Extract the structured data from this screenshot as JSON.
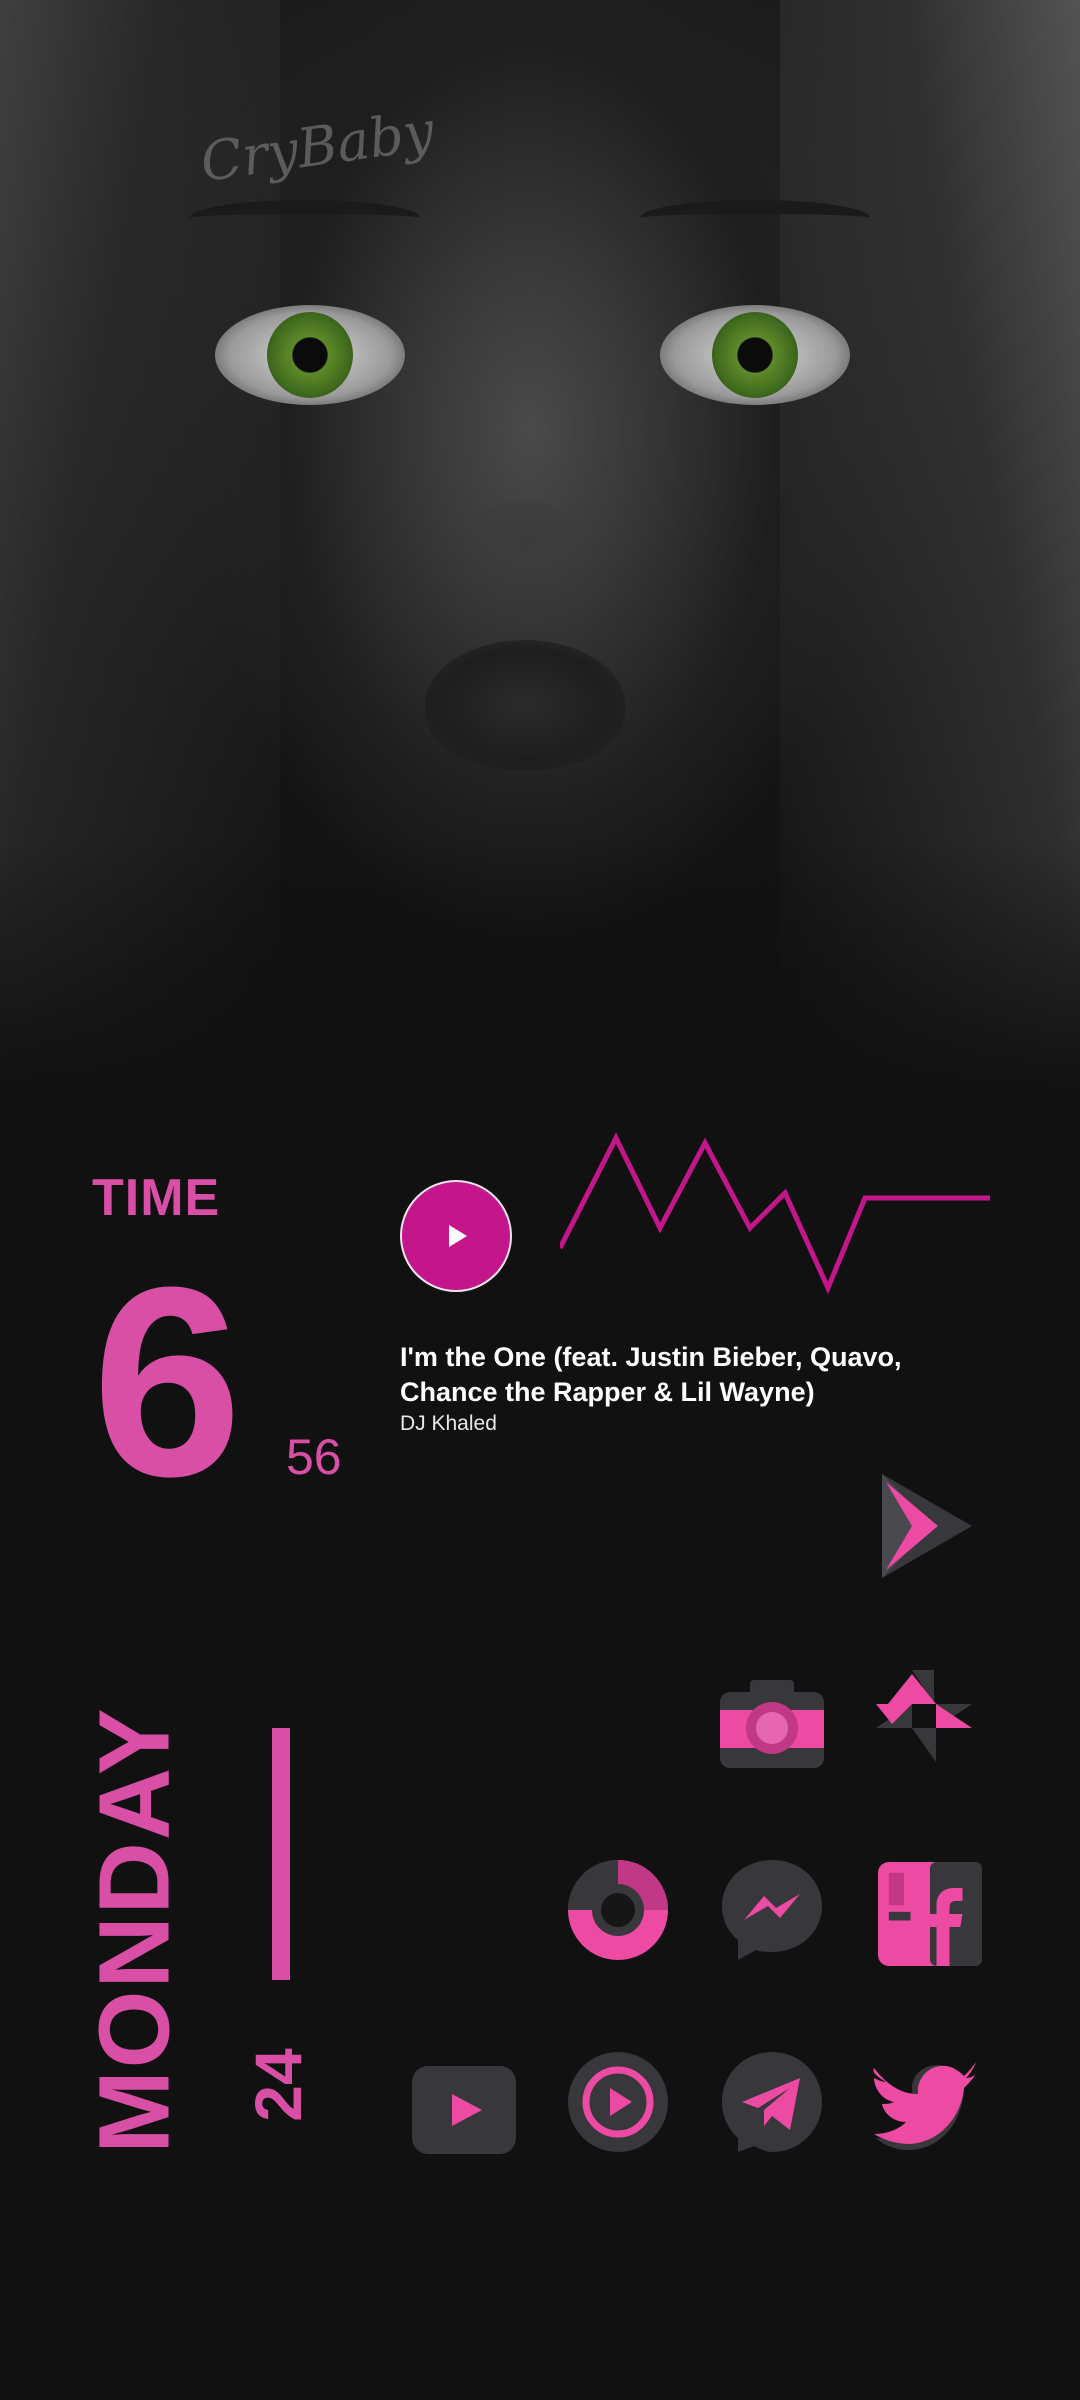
{
  "clock": {
    "label": "TIME",
    "hour": "6",
    "minute": "56"
  },
  "date": {
    "weekday": "MONDAY",
    "day": "24"
  },
  "media": {
    "title": "I'm the One (feat. Justin Bieber, Quavo, Chance the Rapper & Lil Wayne)",
    "artist": "DJ Khaled"
  },
  "wallpaper": {
    "tattoo_text": "CryBaby"
  },
  "colors": {
    "accent": "#d94fa6",
    "accent_dark": "#c4168b",
    "icon_bg": "#38373c",
    "background": "#111112"
  },
  "apps": [
    {
      "name": "play-store-icon"
    },
    {
      "name": "camera-icon"
    },
    {
      "name": "photos-icon"
    },
    {
      "name": "donut-app-icon"
    },
    {
      "name": "messenger-icon"
    },
    {
      "name": "facebook-icon"
    },
    {
      "name": "youtube-icon"
    },
    {
      "name": "music-player-icon"
    },
    {
      "name": "telegram-icon"
    },
    {
      "name": "twitter-icon"
    }
  ]
}
